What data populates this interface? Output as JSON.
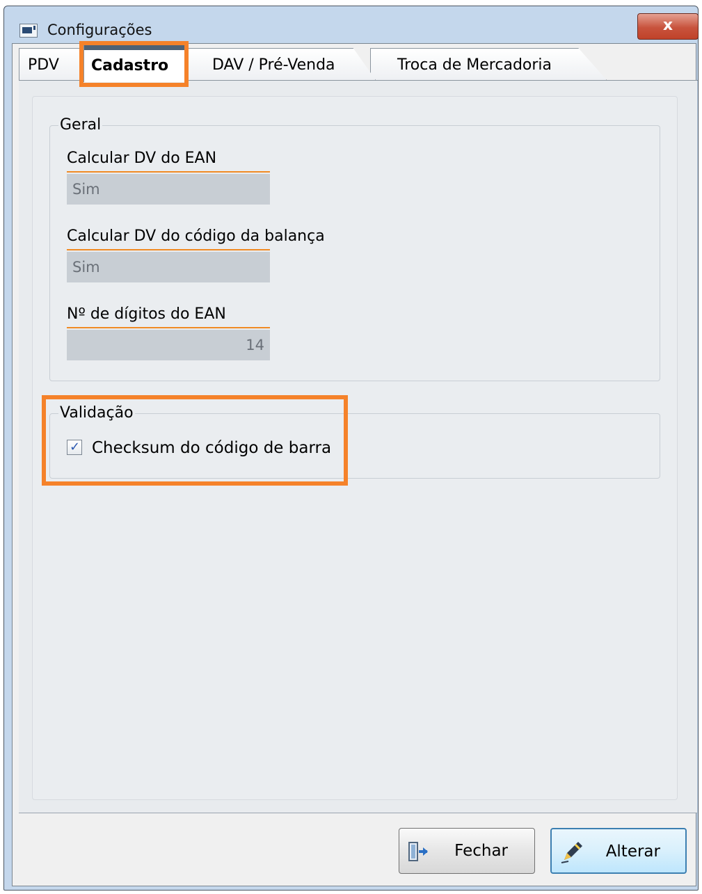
{
  "window": {
    "title": "Configurações",
    "close_label": "x"
  },
  "tabs": [
    {
      "label": "PDV",
      "selected": false
    },
    {
      "label": "Cadastro",
      "selected": true
    },
    {
      "label": "DAV / Pré-Venda",
      "selected": false
    },
    {
      "label": "Troca de Mercadoria",
      "selected": false
    }
  ],
  "geral": {
    "legend": "Geral",
    "fields": [
      {
        "label": "Calcular DV do EAN",
        "value": "Sim"
      },
      {
        "label": "Calcular DV do código da balança",
        "value": "Sim"
      },
      {
        "label": "Nº de dígitos do EAN",
        "value": "14"
      }
    ]
  },
  "validacao": {
    "legend": "Validação",
    "checkbox_label": "Checksum do código de barra",
    "checked": true
  },
  "buttons": {
    "close_label": "Fechar",
    "edit_label": "Alterar"
  },
  "colors": {
    "highlight": "#f5822a",
    "field_underline": "#f08a24",
    "field_bg": "#c8ced4"
  }
}
